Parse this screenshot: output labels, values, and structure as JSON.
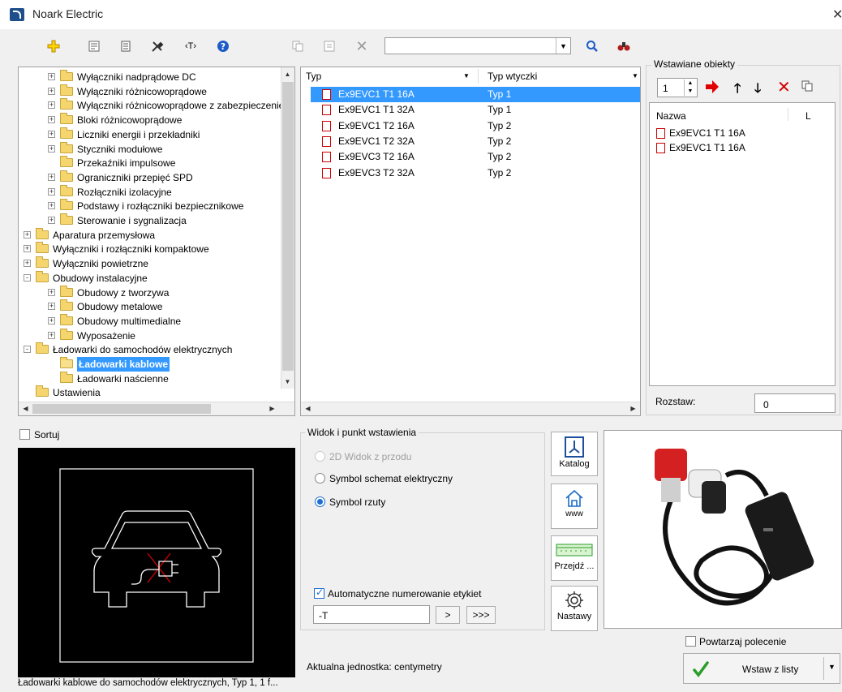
{
  "window": {
    "title": "Noark Electric"
  },
  "toolbar": {
    "search_value": ""
  },
  "tree": {
    "items": [
      {
        "label": "Wyłączniki nadprądowe DC",
        "level": 2,
        "exp": "+"
      },
      {
        "label": "Wyłączniki różnicowoprądowe",
        "level": 2,
        "exp": "+"
      },
      {
        "label": "Wyłączniki różnicowoprądowe z zabezpieczenie",
        "level": 2,
        "exp": "+"
      },
      {
        "label": "Bloki różnicowoprądowe",
        "level": 2,
        "exp": "+"
      },
      {
        "label": "Liczniki energii i przekładniki",
        "level": 2,
        "exp": "+"
      },
      {
        "label": "Styczniki modułowe",
        "level": 2,
        "exp": "+"
      },
      {
        "label": "Przekaźniki impulsowe",
        "level": 2,
        "exp": ""
      },
      {
        "label": "Ograniczniki przepięć SPD",
        "level": 2,
        "exp": "+"
      },
      {
        "label": "Rozłączniki izolacyjne",
        "level": 2,
        "exp": "+"
      },
      {
        "label": "Podstawy i rozłączniki bezpiecznikowe",
        "level": 2,
        "exp": "+"
      },
      {
        "label": "Sterowanie i sygnalizacja",
        "level": 2,
        "exp": "+"
      },
      {
        "label": "Aparatura przemysłowa",
        "level": 1,
        "exp": "+"
      },
      {
        "label": "Wyłączniki i rozłączniki kompaktowe",
        "level": 1,
        "exp": "+"
      },
      {
        "label": "Wyłączniki powietrzne",
        "level": 1,
        "exp": "+"
      },
      {
        "label": "Obudowy instalacyjne",
        "level": 1,
        "exp": "-"
      },
      {
        "label": "Obudowy z tworzywa",
        "level": 2,
        "exp": "+"
      },
      {
        "label": "Obudowy metalowe",
        "level": 2,
        "exp": "+"
      },
      {
        "label": "Obudowy multimedialne",
        "level": 2,
        "exp": "+"
      },
      {
        "label": "Wyposażenie",
        "level": 2,
        "exp": "+"
      },
      {
        "label": "Ładowarki do samochodów elektrycznych",
        "level": 1,
        "exp": "-"
      },
      {
        "label": "Ładowarki kablowe",
        "level": 2,
        "exp": "",
        "selected": true,
        "open": true
      },
      {
        "label": "Ładowarki naścienne",
        "level": 2,
        "exp": ""
      },
      {
        "label": "Ustawienia",
        "level": 1,
        "exp": ""
      }
    ]
  },
  "products": {
    "col_type": "Typ",
    "col_plug": "Typ wtyczki",
    "rows": [
      {
        "name": "Ex9EVC1 T1 16A",
        "plug": "Typ 1",
        "selected": true
      },
      {
        "name": "Ex9EVC1 T1 32A",
        "plug": "Typ 1"
      },
      {
        "name": "Ex9EVC1 T2 16A",
        "plug": "Typ 2"
      },
      {
        "name": "Ex9EVC1 T2 32A",
        "plug": "Typ 2"
      },
      {
        "name": "Ex9EVC3 T2 16A",
        "plug": "Typ 2"
      },
      {
        "name": "Ex9EVC3 T2 32A",
        "plug": "Typ 2"
      }
    ]
  },
  "inserted": {
    "group_label": "Wstawiane obiekty",
    "count": "1",
    "col_name": "Nazwa",
    "col_l": "L",
    "items": [
      "Ex9EVC1 T1 16A",
      "Ex9EVC1 T1 16A"
    ],
    "spacing_label": "Rozstaw:",
    "spacing_value": "0"
  },
  "sort_label": "Sortuj",
  "view_group": {
    "label": "Widok i punkt wstawienia",
    "opt_front": "2D Widok z przodu",
    "opt_schematic": "Symbol schemat elektryczny",
    "opt_plan": "Symbol rzuty",
    "auto_number_label": "Automatyczne numerowanie etykiet",
    "tag_value": "-T",
    "next_btn": ">",
    "next_all_btn": ">>>"
  },
  "side_buttons": {
    "catalog": "Katalog",
    "www": "www",
    "goto": "Przejdź ...",
    "settings": "Nastawy"
  },
  "repeat_label": "Powtarzaj polecenie",
  "insert_button": "Wstaw z listy",
  "unit_text": "Aktualna jednostka: centymetry",
  "status_text": "Ładowarki kablowe do samochodów elektrycznych, Typ 1, 1 f..."
}
